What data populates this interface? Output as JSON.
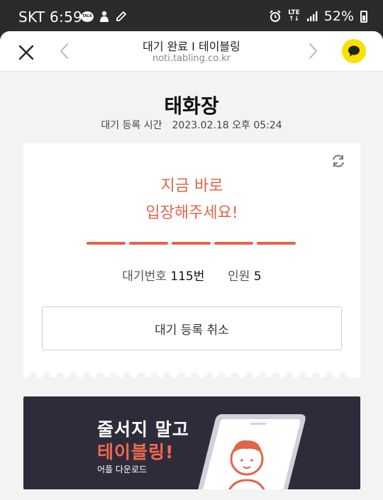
{
  "status_bar": {
    "carrier_time": "SKT 6:59",
    "talk_badge": "TALK",
    "lte_top": "LTE",
    "lte_bottom": "↑↓",
    "battery": "52%"
  },
  "topbar": {
    "title": "대기 완료 I 테이블링",
    "url": "noti.tabling.co.kr",
    "icons": [
      "close-icon",
      "back-chevron-icon",
      "forward-chevron-icon",
      "kakao-talk-icon"
    ]
  },
  "store": {
    "name": "태화장",
    "reg_label": "대기 등록 시간",
    "reg_time": "2023.02.18 오후 05:24"
  },
  "card": {
    "message_line1": "지금 바로",
    "message_line2": "입장해주세요!",
    "progress_segments": 5,
    "queue_label": "대기번호",
    "queue_value": "115번",
    "party_label": "인원",
    "party_value": "5",
    "cancel_label": "대기 등록 취소"
  },
  "banner": {
    "line1": "줄서지 말고",
    "line2": "테이블링!",
    "line3": "어플 다운로드"
  },
  "colors": {
    "accent": "#e0654a",
    "kakao": "#fae100",
    "banner_bg": "#2e2c3b"
  }
}
